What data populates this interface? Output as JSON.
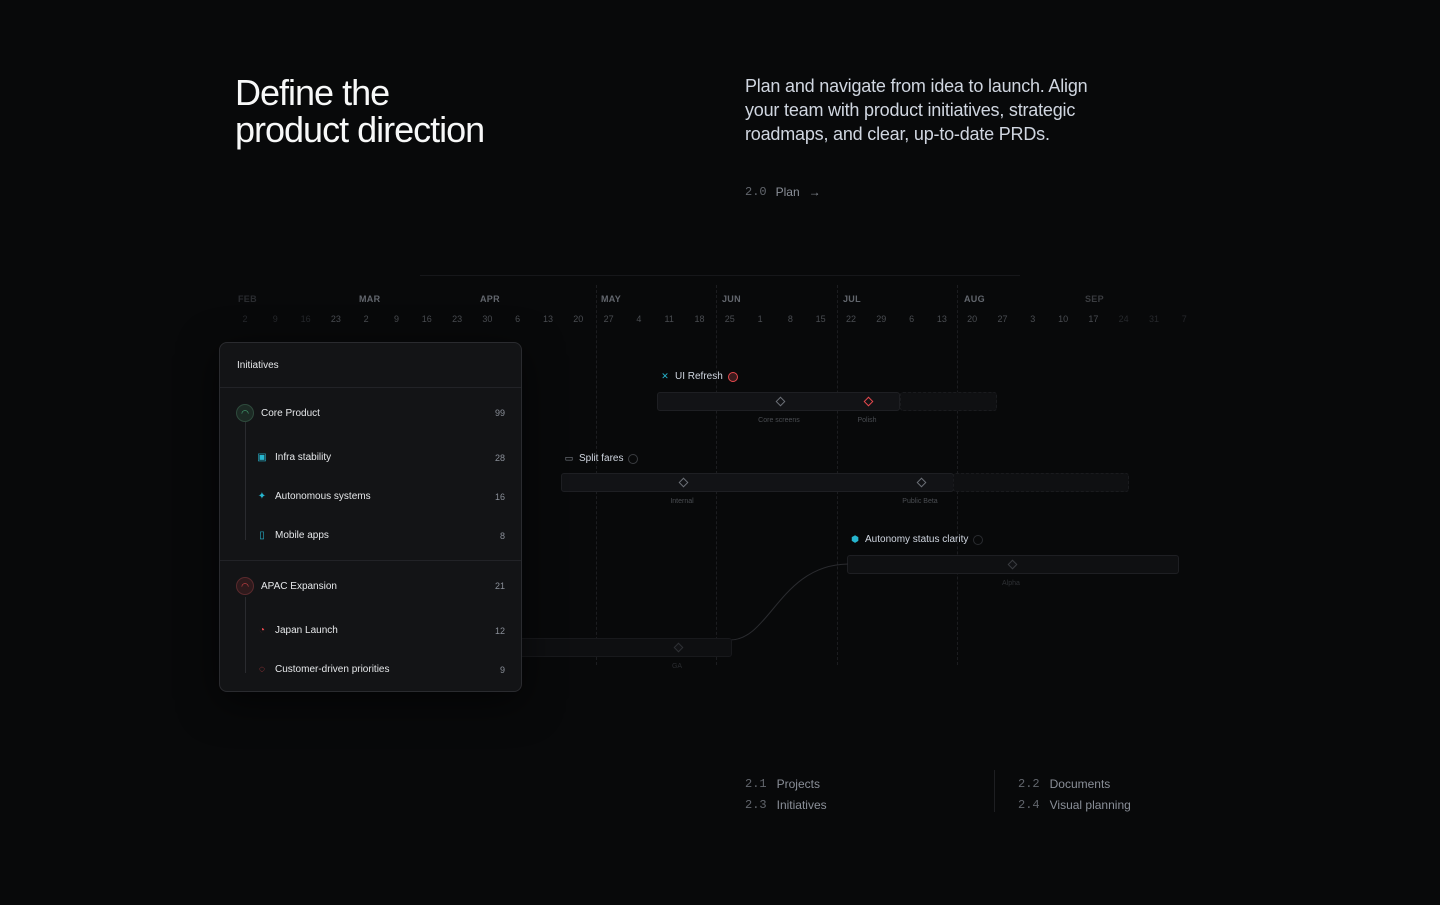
{
  "hero": {
    "title_line1": "Define the",
    "title_line2": "product direction",
    "description": "Plan and navigate from idea to launch. Align your team with product initiatives, strategic roadmaps, and clear, up-to-date PRDs.",
    "link_num": "2.0",
    "link_label": "Plan",
    "link_arrow": "→"
  },
  "timeline": {
    "months": [
      "FEB",
      "MAR",
      "APR",
      "MAY",
      "JUN",
      "JUL",
      "AUG",
      "SEP"
    ],
    "days": [
      "2",
      "9",
      "16",
      "23",
      "2",
      "9",
      "16",
      "23",
      "30",
      "6",
      "13",
      "20",
      "27",
      "4",
      "11",
      "18",
      "25",
      "1",
      "8",
      "15",
      "22",
      "29",
      "6",
      "13",
      "20",
      "27",
      "3",
      "10",
      "17",
      "24",
      "31",
      "7"
    ],
    "projects": [
      {
        "name": "UI Refresh",
        "milestones": [
          "Core screens",
          "Polish"
        ]
      },
      {
        "name": "Split fares",
        "milestones": [
          "Internal",
          "Public Beta"
        ]
      },
      {
        "name": "Autonomy status clarity",
        "milestones": [
          "Alpha"
        ]
      },
      {
        "name": "",
        "milestones": [
          "GA"
        ]
      }
    ]
  },
  "panel": {
    "title": "Initiatives",
    "groups": [
      {
        "name": "Core Product",
        "count": "99",
        "color": "#4cb782",
        "children": [
          {
            "name": "Infra stability",
            "count": "28",
            "icon": "briefcase-icon"
          },
          {
            "name": "Autonomous systems",
            "count": "16",
            "icon": "sparkle-icon"
          },
          {
            "name": "Mobile apps",
            "count": "8",
            "icon": "phone-icon"
          }
        ]
      },
      {
        "name": "APAC Expansion",
        "count": "21",
        "color": "#e5484d",
        "children": [
          {
            "name": "Japan Launch",
            "count": "12",
            "icon": "flag-icon"
          },
          {
            "name": "Customer-driven priorities",
            "count": "9",
            "icon": "chat-icon"
          }
        ]
      }
    ]
  },
  "footer": {
    "links": [
      {
        "num": "2.1",
        "label": "Projects"
      },
      {
        "num": "2.3",
        "label": "Initiatives"
      },
      {
        "num": "2.2",
        "label": "Documents"
      },
      {
        "num": "2.4",
        "label": "Visual planning"
      }
    ]
  },
  "colors": {
    "background": "#08090a",
    "accent_teal": "#26b5ce",
    "accent_red": "#e5484d"
  }
}
